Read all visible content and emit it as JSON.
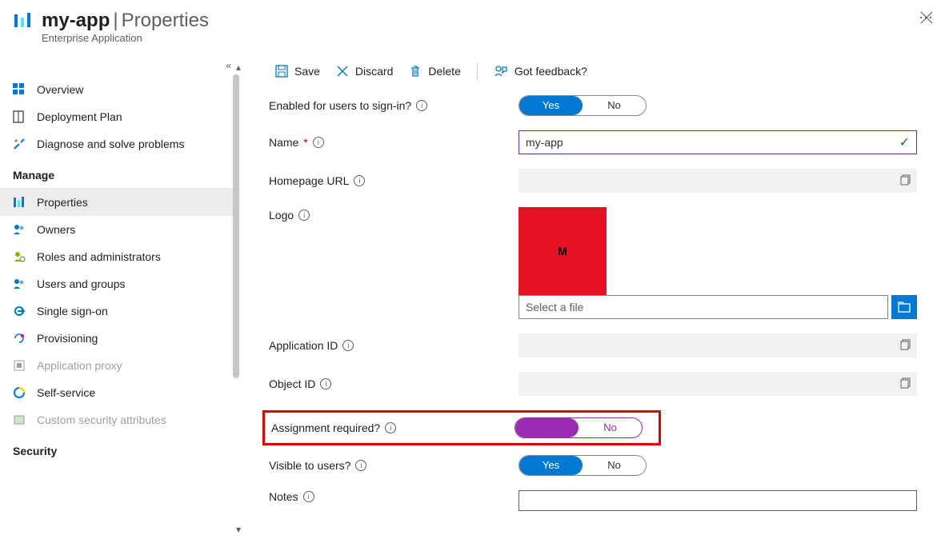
{
  "header": {
    "app_name": "my-app",
    "section": "Properties",
    "subtitle": "Enterprise Application"
  },
  "toolbar": {
    "save": "Save",
    "discard": "Discard",
    "delete": "Delete",
    "feedback": "Got feedback?"
  },
  "sidebar": {
    "items_top": [
      {
        "label": "Overview"
      },
      {
        "label": "Deployment Plan"
      },
      {
        "label": "Diagnose and solve problems"
      }
    ],
    "section_manage": "Manage",
    "items_manage": [
      {
        "label": "Properties"
      },
      {
        "label": "Owners"
      },
      {
        "label": "Roles and administrators"
      },
      {
        "label": "Users and groups"
      },
      {
        "label": "Single sign-on"
      },
      {
        "label": "Provisioning"
      },
      {
        "label": "Application proxy"
      },
      {
        "label": "Self-service"
      },
      {
        "label": "Custom security attributes"
      }
    ],
    "section_security": "Security"
  },
  "form": {
    "enabled_label": "Enabled for users to sign-in?",
    "name_label": "Name",
    "name_value": "my-app",
    "homepage_label": "Homepage URL",
    "logo_label": "Logo",
    "logo_letter": "M",
    "file_placeholder": "Select a file",
    "appid_label": "Application ID",
    "objid_label": "Object ID",
    "assignment_label": "Assignment required?",
    "visible_label": "Visible to users?",
    "notes_label": "Notes",
    "yes": "Yes",
    "no": "No"
  }
}
